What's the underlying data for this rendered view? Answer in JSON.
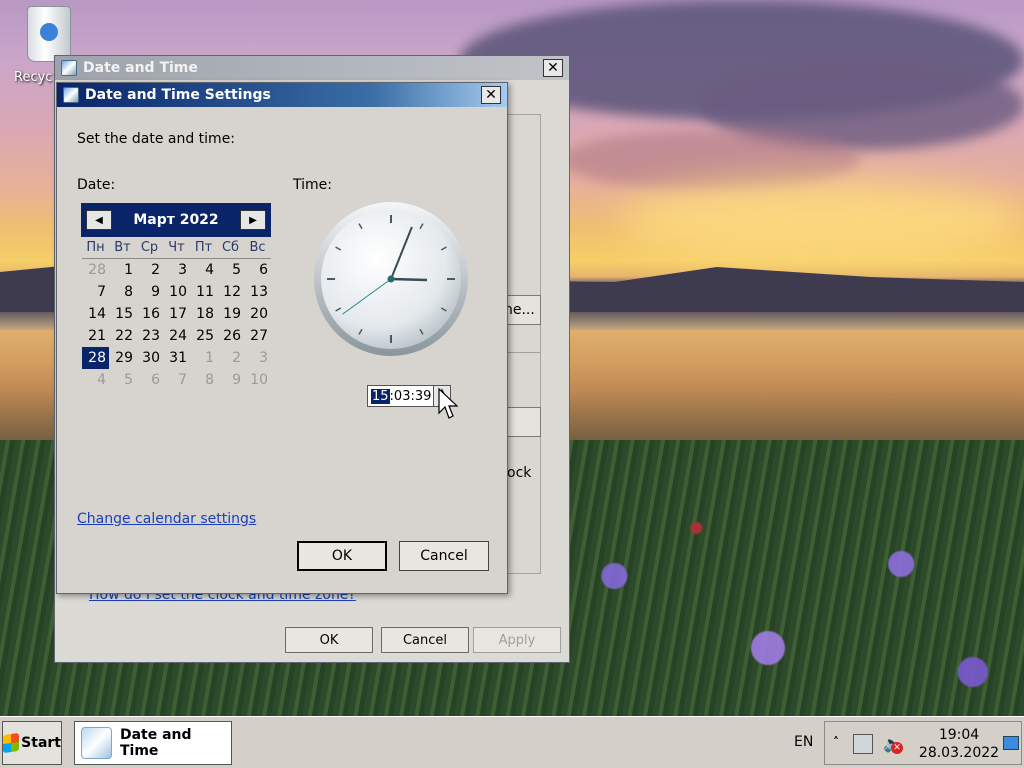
{
  "desktop": {
    "icon_label": "Recyc"
  },
  "back_window": {
    "title": "Date and Time",
    "change_btn_partial": "ne...",
    "clock_text_partial": "ock",
    "help_link": "How do I set the clock and time zone?",
    "ok": "OK",
    "cancel": "Cancel",
    "apply": "Apply"
  },
  "dialog": {
    "title": "Date and Time Settings",
    "instruction": "Set the date and time:",
    "date_label": "Date:",
    "time_label": "Time:",
    "calendar": {
      "month": "Март 2022",
      "weekdays": [
        "Пн",
        "Вт",
        "Ср",
        "Чт",
        "Пт",
        "Сб",
        "Вс"
      ],
      "weeks": [
        [
          "28",
          "1",
          "2",
          "3",
          "4",
          "5",
          "6"
        ],
        [
          "7",
          "8",
          "9",
          "10",
          "11",
          "12",
          "13"
        ],
        [
          "14",
          "15",
          "16",
          "17",
          "18",
          "19",
          "20"
        ],
        [
          "21",
          "22",
          "23",
          "24",
          "25",
          "26",
          "27"
        ],
        [
          "28",
          "29",
          "30",
          "31",
          "1",
          "2",
          "3"
        ],
        [
          "4",
          "5",
          "6",
          "7",
          "8",
          "9",
          "10"
        ]
      ],
      "selected_day": "28"
    },
    "time": {
      "hours": "15",
      "rest": ":03:39"
    },
    "clock_face": {
      "hour": 15,
      "minute": 3,
      "second": 39
    },
    "change_calendar_link": "Change calendar settings",
    "ok": "OK",
    "cancel": "Cancel"
  },
  "taskbar": {
    "start": "Start",
    "task_label": "Date and Time",
    "language": "EN",
    "time": "19:04",
    "date": "28.03.2022"
  },
  "colors": {
    "titlebar_active": "#0a246a",
    "link": "#1c3fb8",
    "selected_day_bg": "#0a246a"
  }
}
